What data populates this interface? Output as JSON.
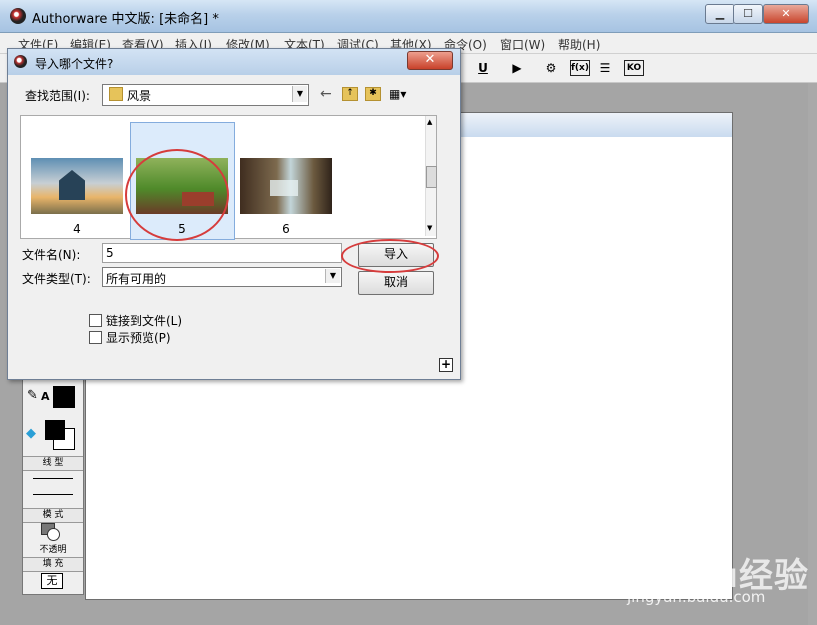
{
  "window": {
    "title": "Authorware 中文版: [未命名] *",
    "min": "▁",
    "max": "☐",
    "close": "✕"
  },
  "menu": [
    "文件(F)",
    "编辑(E)",
    "查看(V)",
    "插入(I)",
    "修改(M)",
    "文本(T)",
    "调试(C)",
    "其他(X)",
    "命令(O)",
    "窗口(W)",
    "帮助(H)"
  ],
  "toolbar": {
    "underline": "U",
    "fo": "f(x)",
    "ko": "KO"
  },
  "palette": {
    "section_lines": "线 型",
    "section_mode": "模 式",
    "mode_opaque": "不透明",
    "section_fill": "填 充",
    "fill_none": "无",
    "text_tool": "A"
  },
  "dialog": {
    "title": "导入哪个文件?",
    "close": "✕",
    "lookin_label": "查找范围(I):",
    "lookin_value": "风景",
    "files": [
      {
        "name": "4"
      },
      {
        "name": "5",
        "selected": true
      },
      {
        "name": "6"
      }
    ],
    "filename_label": "文件名(N):",
    "filename_value": "5",
    "filetype_label": "文件类型(T):",
    "filetype_value": "所有可用的",
    "import_button": "导入",
    "cancel_button": "取消",
    "link_checkbox": "链接到文件(L)",
    "preview_checkbox": "显示预览(P)",
    "expand_button": "+"
  },
  "watermark": {
    "brand": "Baidu经验",
    "url": "jingyan.baidu.com"
  },
  "colors": {
    "highlight_circle": "#d63c3c",
    "selected_bg": "#dcebfb"
  }
}
